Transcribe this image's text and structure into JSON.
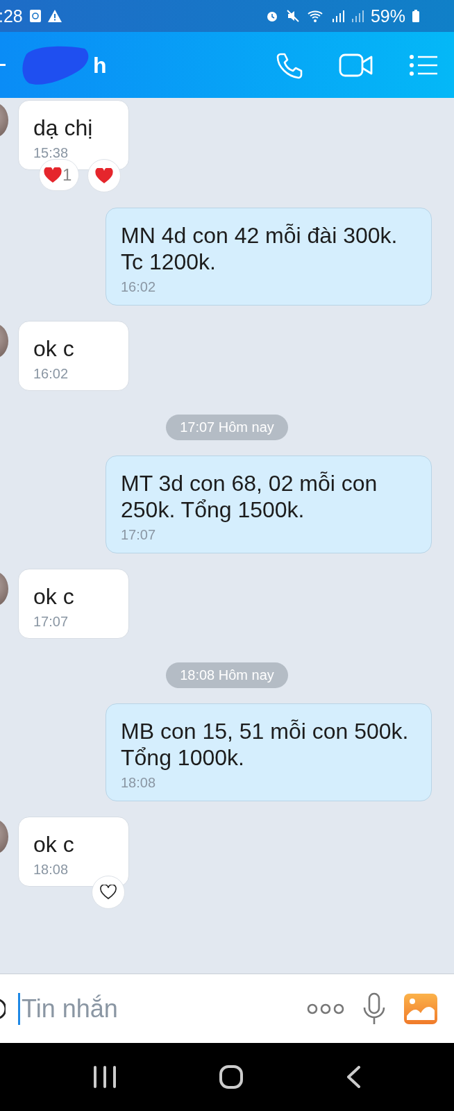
{
  "status_bar": {
    "time": ":28",
    "battery": "59%"
  },
  "header": {
    "title": "h"
  },
  "messages": [
    {
      "kind": "incoming",
      "text": "dạ chị",
      "time": "15:38",
      "reaction": {
        "count": "1"
      },
      "liked": true
    },
    {
      "kind": "outgoing",
      "text": "MN 4d con 42 mỗi đài 300k. Tc 1200k.",
      "time": "16:02"
    },
    {
      "kind": "incoming",
      "text": "ok c",
      "time": "16:02"
    },
    {
      "kind": "date",
      "text": "17:07 Hôm nay"
    },
    {
      "kind": "outgoing",
      "text": "MT 3d con 68, 02 mỗi con 250k. Tổng 1500k.",
      "time": "17:07"
    },
    {
      "kind": "incoming",
      "text": "ok c",
      "time": "17:07"
    },
    {
      "kind": "date",
      "text": "18:08 Hôm nay"
    },
    {
      "kind": "outgoing",
      "text": "MB con 15, 51 mỗi con 500k. Tổng 1000k.",
      "time": "18:08"
    },
    {
      "kind": "incoming",
      "text": "ok c",
      "time": "18:08",
      "liked": false
    }
  ],
  "composer": {
    "placeholder": "Tin nhắn"
  }
}
